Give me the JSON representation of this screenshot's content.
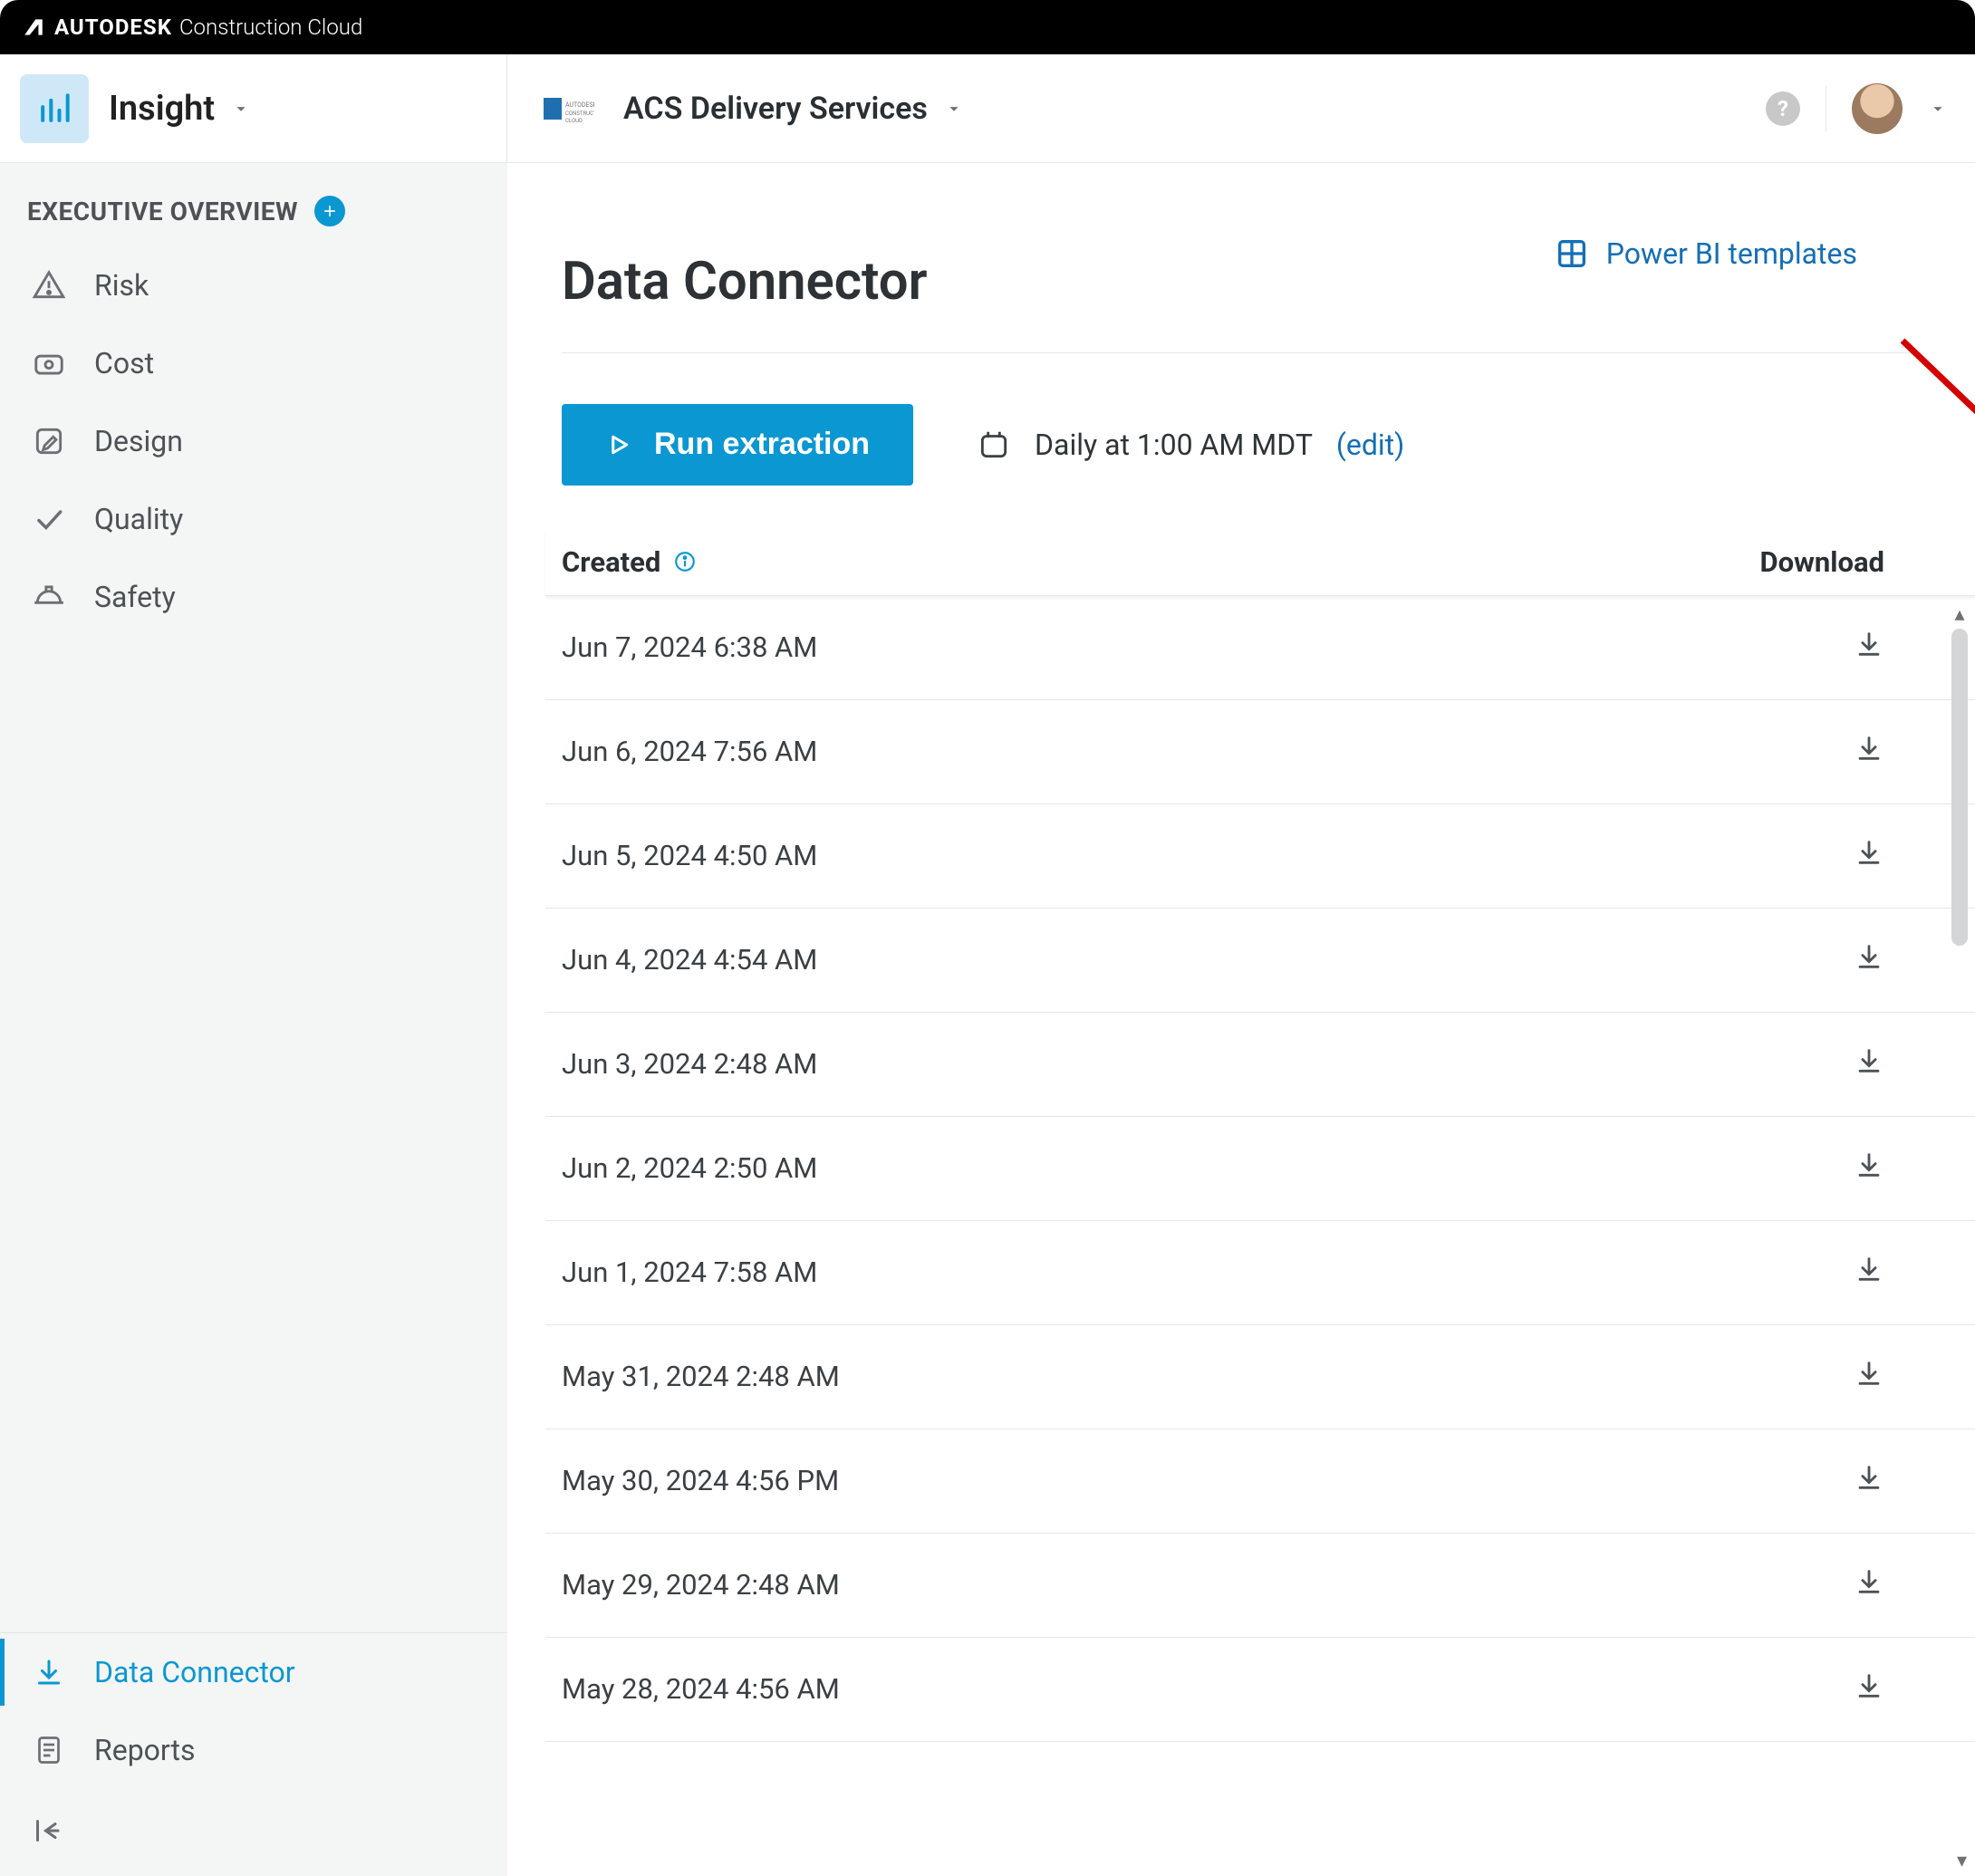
{
  "brand": {
    "strong": "AUTODESK",
    "light": "Construction Cloud"
  },
  "header": {
    "module": "Insight",
    "project": "ACS Delivery Services"
  },
  "sidebar": {
    "section": "EXECUTIVE OVERVIEW",
    "items": [
      {
        "label": "Risk"
      },
      {
        "label": "Cost"
      },
      {
        "label": "Design"
      },
      {
        "label": "Quality"
      },
      {
        "label": "Safety"
      }
    ],
    "bottom": [
      {
        "label": "Data Connector",
        "active": true
      },
      {
        "label": "Reports",
        "active": false
      }
    ]
  },
  "main": {
    "title": "Data Connector",
    "topright_link": "Power BI templates",
    "run_button": "Run extraction",
    "schedule_text": "Daily at 1:00 AM MDT",
    "edit_label": "(edit)",
    "columns": {
      "created": "Created",
      "download": "Download"
    },
    "rows": [
      {
        "created": "Jun 7, 2024 6:38 AM"
      },
      {
        "created": "Jun 6, 2024 7:56 AM"
      },
      {
        "created": "Jun 5, 2024 4:50 AM"
      },
      {
        "created": "Jun 4, 2024 4:54 AM"
      },
      {
        "created": "Jun 3, 2024 2:48 AM"
      },
      {
        "created": "Jun 2, 2024 2:50 AM"
      },
      {
        "created": "Jun 1, 2024 7:58 AM"
      },
      {
        "created": "May 31, 2024 2:48 AM"
      },
      {
        "created": "May 30, 2024 4:56 PM"
      },
      {
        "created": "May 29, 2024 2:48 AM"
      },
      {
        "created": "May 28, 2024 4:56 AM"
      }
    ]
  }
}
